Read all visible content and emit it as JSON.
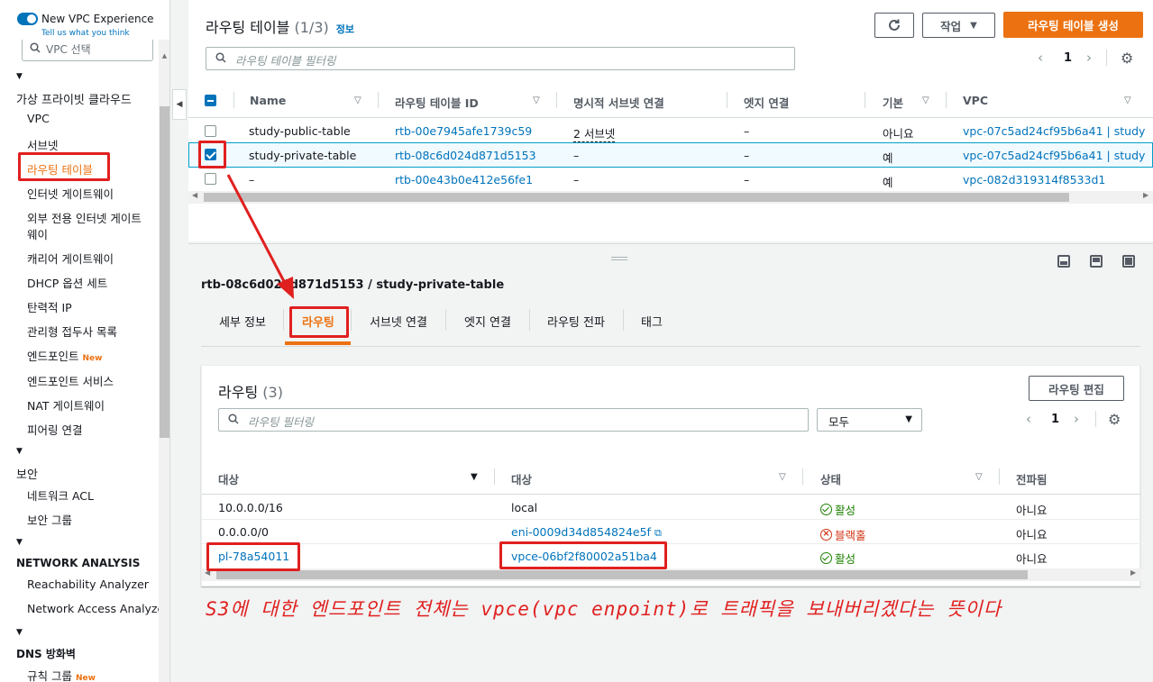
{
  "sidebar": {
    "toggle_label": "New VPC Experience",
    "tell_us": "Tell us what you think",
    "search_placeholder": "VPC 선택",
    "sections": [
      {
        "title": "가상 프라이빗 클라우드",
        "items": [
          "VPC",
          "서브넷",
          "라우팅 테이블",
          "인터넷 게이트웨이",
          "외부 전용 인터넷 게이트",
          "웨이",
          "캐리어 게이트웨이",
          "DHCP 옵션 세트",
          "탄력적 IP",
          "관리형 접두사 목록",
          "엔드포인트",
          "엔드포인트 서비스",
          "NAT 게이트웨이",
          "피어링 연결"
        ]
      },
      {
        "title": "보안",
        "items": [
          "네트워크 ACL",
          "보안 그룹"
        ]
      },
      {
        "title": "NETWORK ANALYSIS",
        "items": [
          "Reachability Analyzer",
          "Network Access Analyzer"
        ]
      },
      {
        "title": "DNS 방화벽",
        "items": [
          "규칙 그룹"
        ]
      }
    ],
    "new_badge": "New"
  },
  "route_tables": {
    "title": "라우팅 테이블",
    "count": "(1/3)",
    "info": "정보",
    "refresh_icon": "refresh-icon",
    "actions_label": "작업",
    "create_label": "라우팅 테이블 생성",
    "filter_placeholder": "라우팅 테이블 필터링",
    "page": "1",
    "columns": [
      "Name",
      "라우팅 테이블 ID",
      "명시적 서브넷 연결",
      "엣지 연결",
      "기본",
      "VPC"
    ],
    "rows": [
      {
        "name": "study-public-table",
        "id": "rtb-00e7945afe1739c59",
        "subnet": "2 서브넷",
        "edge": "–",
        "main": "아니요",
        "vpc": "vpc-07c5ad24cf95b6a41 | study",
        "checked": false
      },
      {
        "name": "study-private-table",
        "id": "rtb-08c6d024d871d5153",
        "subnet": "–",
        "edge": "–",
        "main": "예",
        "vpc": "vpc-07c5ad24cf95b6a41 | study",
        "checked": true
      },
      {
        "name": "–",
        "id": "rtb-00e43b0e412e56fe1",
        "subnet": "–",
        "edge": "–",
        "main": "예",
        "vpc": "vpc-082d319314f8533d1",
        "checked": false
      }
    ]
  },
  "detail": {
    "breadcrumb": "rtb-08c6d024d871d5153 / study-private-table",
    "tabs": [
      "세부 정보",
      "라우팅",
      "서브넷 연결",
      "엣지 연결",
      "라우팅 전파",
      "태그"
    ],
    "active_tab": "라우팅",
    "routes_title": "라우팅",
    "routes_count": "(3)",
    "edit_label": "라우팅 편집",
    "filter_placeholder": "라우팅 필터링",
    "filter_select": "모두",
    "page": "1",
    "columns": [
      "대상",
      "대상",
      "상태",
      "전파됨"
    ],
    "routes": [
      {
        "destination": "10.0.0.0/16",
        "target": "local",
        "status": "활성",
        "status_type": "ok",
        "propagated": "아니요",
        "dest_link": false,
        "target_link": false
      },
      {
        "destination": "0.0.0.0/0",
        "target": "eni-0009d34d854824e5f",
        "status": "블랙홀",
        "status_type": "error",
        "propagated": "아니요",
        "dest_link": false,
        "target_link": true
      },
      {
        "destination": "pl-78a54011",
        "target": "vpce-06bf2f80002a51ba4",
        "status": "활성",
        "status_type": "ok",
        "propagated": "아니요",
        "dest_link": true,
        "target_link": true
      }
    ]
  },
  "annotation": "S3에 대한 엔드포인트 전체는 vpce(vpc enpoint)로 트래픽을 보내버리겠다는 뜻이다",
  "colors": {
    "accent": "#ec7211",
    "link": "#0073bb",
    "annotation": "#e0201f"
  }
}
